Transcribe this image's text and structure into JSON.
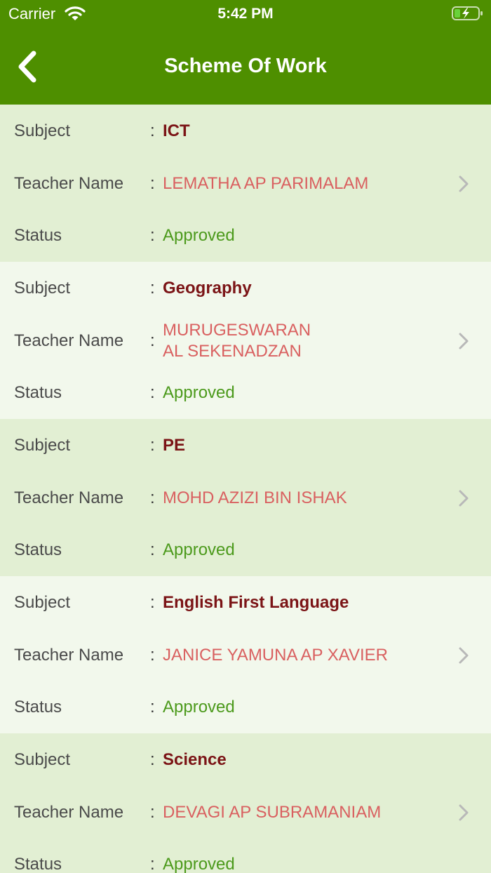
{
  "status_bar": {
    "carrier": "Carrier",
    "time": "5:42 PM",
    "icons": [
      "wifi-icon",
      "battery-charging-icon"
    ]
  },
  "nav": {
    "title": "Scheme Of Work",
    "back_icon": "chevron-left-icon"
  },
  "labels": {
    "subject": "Subject",
    "teacher": "Teacher Name",
    "status": "Status",
    "separator": ":"
  },
  "items": [
    {
      "subject": "ICT",
      "teacher": [
        "LEMATHA AP PARIMALAM"
      ],
      "status": "Approved"
    },
    {
      "subject": "Geography",
      "teacher": [
        "MURUGESWARAN",
        "AL SEKENADZAN"
      ],
      "status": "Approved"
    },
    {
      "subject": "PE",
      "teacher": [
        "MOHD AZIZI BIN ISHAK"
      ],
      "status": "Approved"
    },
    {
      "subject": "English First Language",
      "teacher": [
        "JANICE YAMUNA AP XAVIER"
      ],
      "status": "Approved"
    },
    {
      "subject": "Science",
      "teacher": [
        "DEVAGI AP SUBRAMANIAM"
      ],
      "status": "Approved"
    }
  ],
  "colors": {
    "header": "#4e8f00",
    "row_odd": "#e2efd3",
    "row_even": "#f2f8ec",
    "subject": "#7b1416",
    "teacher": "#d96060",
    "status": "#4c9a1c"
  }
}
